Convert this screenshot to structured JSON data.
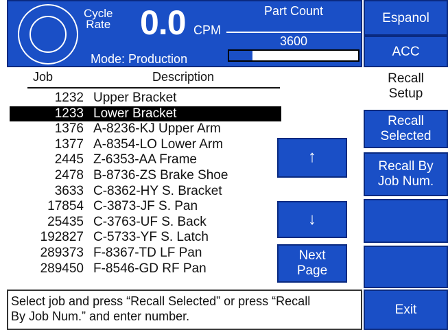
{
  "header": {
    "cycle_rate_label_line1": "Cycle",
    "cycle_rate_label_line2": "Rate",
    "rate_value": "0.0",
    "rate_unit": "CPM",
    "mode": "Mode: Production",
    "part_count_title": "Part Count",
    "part_count_value": "3600",
    "part_count_progress": 0.18
  },
  "table": {
    "headers": {
      "job": "Job",
      "description": "Description"
    },
    "rows": [
      {
        "job": "1232",
        "description": "Upper Bracket",
        "selected": false
      },
      {
        "job": "1233",
        "description": "Lower Bracket",
        "selected": true
      },
      {
        "job": "1376",
        "description": "A-8236-KJ Upper Arm",
        "selected": false
      },
      {
        "job": "1377",
        "description": "A-8354-LO Lower Arm",
        "selected": false
      },
      {
        "job": "2445",
        "description": "Z-6353-AA Frame",
        "selected": false
      },
      {
        "job": "2478",
        "description": "B-8736-ZS Brake Shoe",
        "selected": false
      },
      {
        "job": "3633",
        "description": "C-8362-HY S. Bracket",
        "selected": false
      },
      {
        "job": "17854",
        "description": "C-3873-JF S. Pan",
        "selected": false
      },
      {
        "job": "25435",
        "description": "C-3763-UF S. Back",
        "selected": false
      },
      {
        "job": "192827",
        "description": "C-5733-YF S. Latch",
        "selected": false
      },
      {
        "job": "289373",
        "description": "F-8367-TD LF Pan",
        "selected": false
      },
      {
        "job": "289450",
        "description": "F-8546-GD RF Pan",
        "selected": false
      }
    ]
  },
  "nav": {
    "up_icon": "↑",
    "down_icon": "↓",
    "next_page_line1": "Next",
    "next_page_line2": "Page"
  },
  "side": {
    "espanol": "Espanol",
    "acc": "ACC",
    "title_line1": "Recall",
    "title_line2": "Setup",
    "recall_selected_line1": "Recall",
    "recall_selected_line2": "Selected",
    "recall_by_job_line1": "Recall By",
    "recall_by_job_line2": "Job Num.",
    "exit": "Exit"
  },
  "message": {
    "line1": "Select job and press  “Recall Selected”  or press  “Recall",
    "line2": "By Job Num.”  and enter number."
  },
  "colors": {
    "accent_blue": "#1a4fc6",
    "selected_row": "#000000"
  }
}
